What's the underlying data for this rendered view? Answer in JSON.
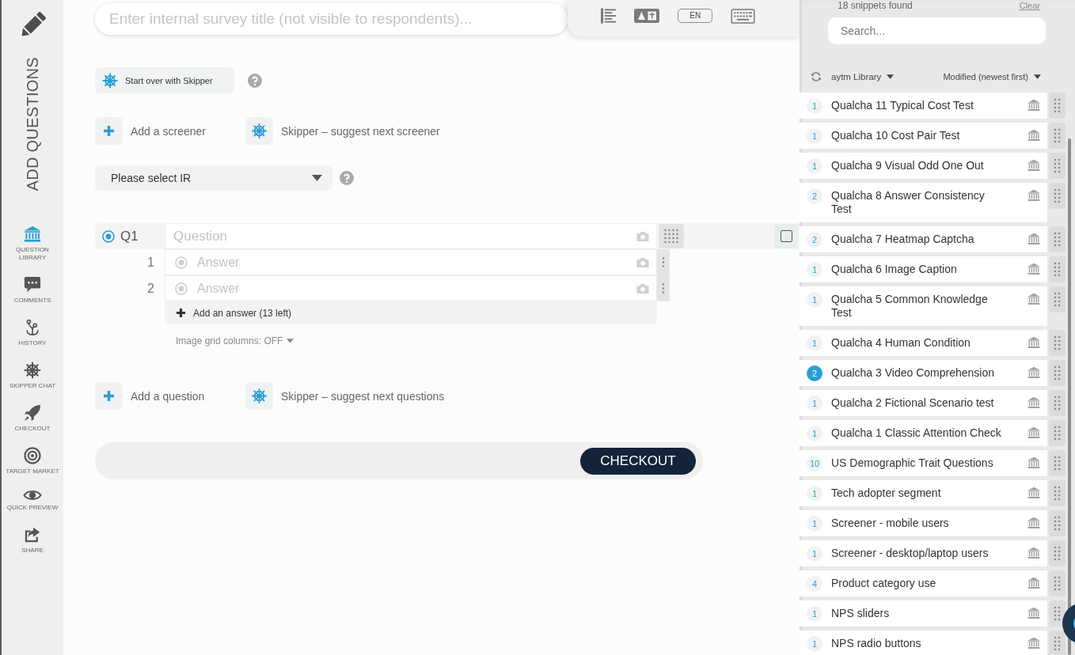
{
  "sidebar": {
    "heading": "ADD QUESTIONS",
    "items": [
      {
        "label": "QUESTION LIBRARY",
        "selected": true
      },
      {
        "label": "COMMENTS",
        "selected": false
      },
      {
        "label": "HISTORY",
        "selected": false
      },
      {
        "label": "SKIPPER CHAT",
        "selected": false
      },
      {
        "label": "CHECKOUT",
        "selected": false
      },
      {
        "label": "TARGET MARKET",
        "selected": false
      },
      {
        "label": "QUICK PREVIEW",
        "selected": false
      },
      {
        "label": "SHARE",
        "selected": false
      }
    ]
  },
  "title_field": {
    "placeholder": "Enter internal survey title (not visible to respondents)..."
  },
  "toolbar": {
    "language": "EN"
  },
  "skipper_restart": {
    "label": "Start over with Skipper"
  },
  "screener_actions": [
    {
      "kind": "add",
      "label": "Add a screener"
    },
    {
      "kind": "skipper",
      "label": "Skipper – suggest next screener"
    }
  ],
  "ir_select": {
    "value": "Please select IR"
  },
  "question": {
    "number": "Q1",
    "selected": true,
    "placeholder": "Question",
    "checked": false,
    "answers": [
      {
        "number": "1",
        "placeholder": "Answer"
      },
      {
        "number": "2",
        "placeholder": "Answer"
      }
    ],
    "add_answer": "Add an answer (13 left)",
    "image_grid": "Image grid columns: OFF"
  },
  "question_actions": [
    {
      "kind": "add",
      "label": "Add a question"
    },
    {
      "kind": "skipper",
      "label": "Skipper – suggest next questions"
    }
  ],
  "checkout": {
    "label": "CHECKOUT"
  },
  "library": {
    "count": "18 snippets found",
    "clear": "Clear",
    "search": {
      "placeholder": "Search..."
    },
    "source": "aytm Library",
    "sort": "Modified (newest first)",
    "items": [
      {
        "count": "1",
        "title": "Qualcha 11 Typical Cost Test",
        "highlighted": false
      },
      {
        "count": "1",
        "title": "Qualcha 10 Cost Pair Test",
        "highlighted": false
      },
      {
        "count": "1",
        "title": "Qualcha 9 Visual Odd One Out",
        "highlighted": false
      },
      {
        "count": "2",
        "title": "Qualcha 8 Answer Consistency Test",
        "highlighted": false
      },
      {
        "count": "2",
        "title": "Qualcha 7 Heatmap Captcha",
        "highlighted": false
      },
      {
        "count": "1",
        "title": "Qualcha 6 Image Caption",
        "highlighted": false
      },
      {
        "count": "1",
        "title": "Qualcha 5 Common Knowledge Test",
        "highlighted": false
      },
      {
        "count": "1",
        "title": "Qualcha 4 Human Condition",
        "highlighted": false
      },
      {
        "count": "2",
        "title": "Qualcha 3 Video Comprehension",
        "highlighted": true
      },
      {
        "count": "1",
        "title": "Qualcha 2 Fictional Scenario test",
        "highlighted": false
      },
      {
        "count": "1",
        "title": "Qualcha 1 Classic Attention Check",
        "highlighted": false
      },
      {
        "count": "10",
        "title": "US Demographic Trait Questions",
        "highlighted": false
      },
      {
        "count": "1",
        "title": "Tech adopter segment",
        "highlighted": false
      },
      {
        "count": "1",
        "title": "Screener - mobile users",
        "highlighted": false
      },
      {
        "count": "1",
        "title": "Screener - desktop/laptop users",
        "highlighted": false
      },
      {
        "count": "4",
        "title": "Product category use",
        "highlighted": false
      },
      {
        "count": "1",
        "title": "NPS sliders",
        "highlighted": false
      },
      {
        "count": "1",
        "title": "NPS radio buttons",
        "highlighted": false
      }
    ]
  }
}
